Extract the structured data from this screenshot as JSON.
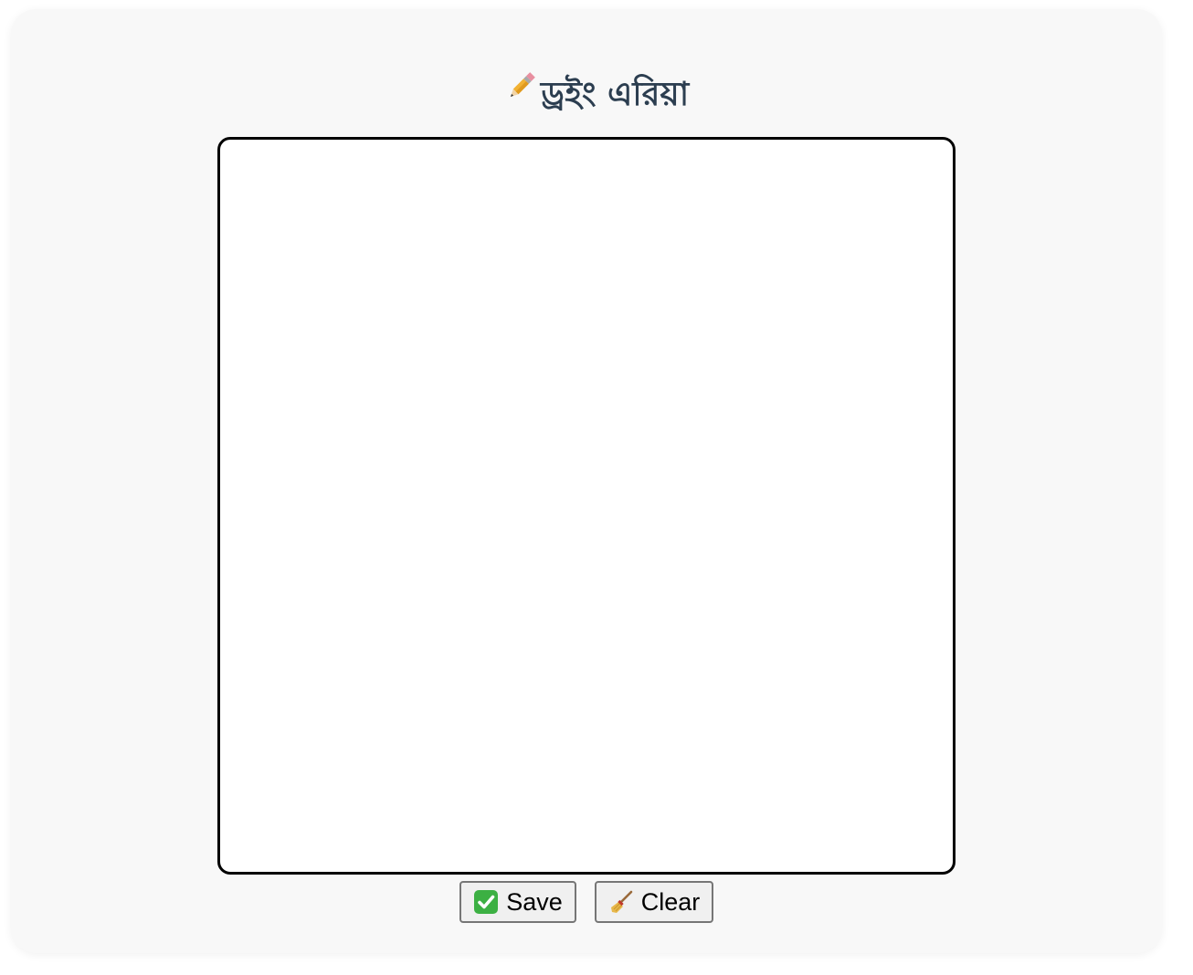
{
  "header": {
    "title": "ড্রইং এরিয়া",
    "title_icon": "pencil-icon"
  },
  "canvas": {
    "name": "drawing-canvas"
  },
  "buttons": {
    "save_label": "Save",
    "save_icon": "check-mark-icon",
    "clear_label": "Clear",
    "clear_icon": "broom-icon"
  },
  "colors": {
    "panel_background": "#f8f8f8",
    "title_color": "#2c3e50",
    "canvas_border": "#000000",
    "save_icon_green": "#3cb043"
  }
}
